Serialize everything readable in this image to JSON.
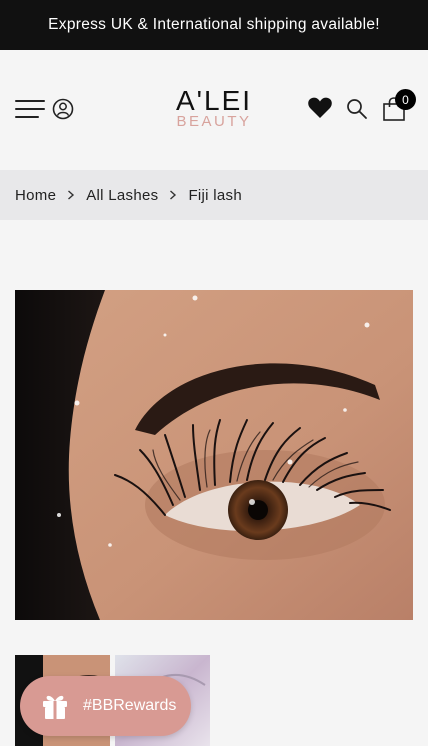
{
  "announcement": "Express UK & International shipping available!",
  "header": {
    "logo_top": "A'LEI",
    "logo_bottom": "BEAUTY",
    "cart_count": "0"
  },
  "breadcrumb": {
    "items": [
      "Home",
      "All Lashes",
      "Fiji lash"
    ]
  },
  "rewards": {
    "label": "#BBRewards"
  },
  "colors": {
    "brand_pink": "#d89a93",
    "topbar_bg": "#111111"
  },
  "icons": [
    "menu-icon",
    "user-icon",
    "heart-icon",
    "search-icon",
    "cart-icon",
    "chevron-right-icon",
    "gift-icon"
  ]
}
